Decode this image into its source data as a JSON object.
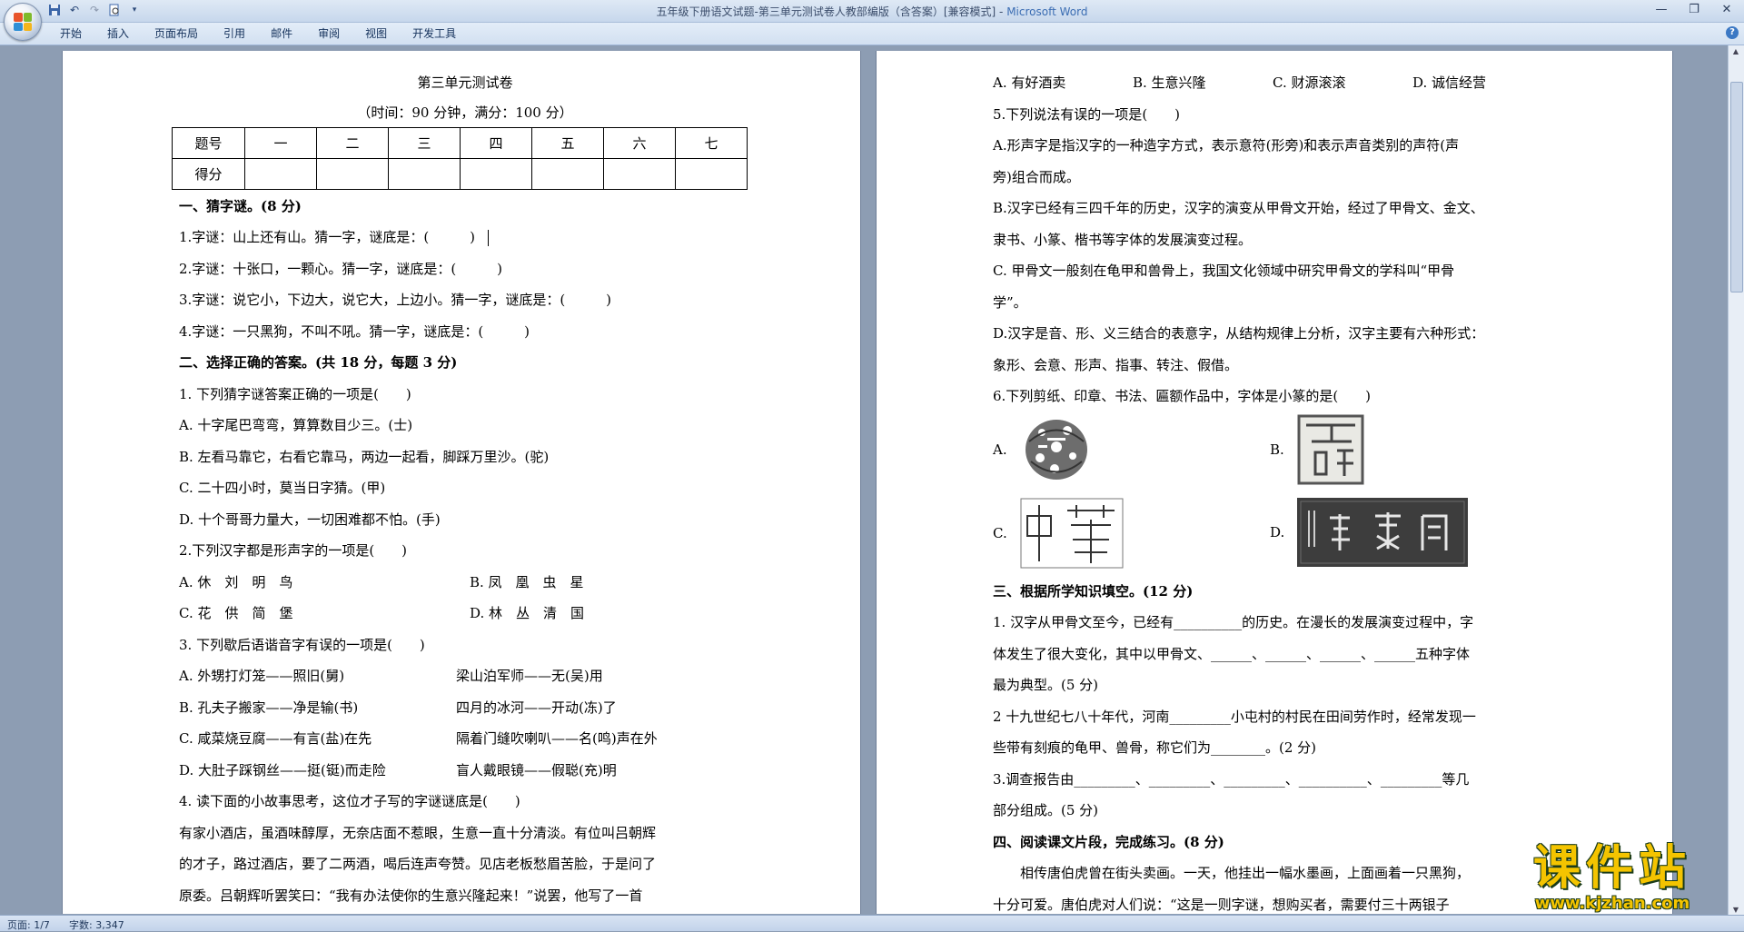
{
  "window": {
    "title": "五年级下册语文试题-第三单元测试卷人教部编版（含答案）[兼容模式]",
    "app_name": "Microsoft Word",
    "title_separator": " - "
  },
  "ribbon": {
    "tabs": [
      "开始",
      "插入",
      "页面布局",
      "引用",
      "邮件",
      "审阅",
      "视图",
      "开发工具"
    ]
  },
  "left_page": {
    "title": "第三单元测试卷",
    "subtitle": "（时间：90 分钟，满分：100 分）",
    "table": {
      "header": [
        "题号",
        "一",
        "二",
        "三",
        "四",
        "五",
        "六",
        "七"
      ],
      "row_label": "得分"
    },
    "lines": [
      {
        "text": "一、猜字谜。(8 分)",
        "bold": true
      },
      {
        "text": "1.字谜：山上还有山。猜一字，谜底是：(　　　)"
      },
      {
        "text": "2.字谜：十张口，一颗心。猜一字，谜底是：(　　　)"
      },
      {
        "text": "3.字谜：说它小，下边大，说它大，上边小。猜一字，谜底是：(　　　)"
      },
      {
        "text": "4.字谜：一只黑狗，不叫不吼。猜一字，谜底是：(　　　)"
      },
      {
        "text": "二、选择正确的答案。(共 18 分，每题 3 分)",
        "bold": true
      },
      {
        "text": "1. 下列猜字谜答案正确的一项是(　　)"
      },
      {
        "text": "A. 十字尾巴弯弯，算算数目少三。(士)"
      },
      {
        "text": "B. 左看马靠它，右看它靠马，两边一起看，脚踩万里沙。(驼)"
      },
      {
        "text": "C. 二十四小时，莫当日字猜。(甲)"
      },
      {
        "text": "D. 十个哥哥力量大，一切困难都不怕。(手)"
      },
      {
        "text": "2.下列汉字都是形声字的一项是(　　)"
      }
    ],
    "q2_options": [
      [
        "A. 休　刘　明　鸟",
        "B. 凤　凰　虫　星"
      ],
      [
        "C. 花　供　简　堡",
        "D. 林　丛　清　国"
      ]
    ],
    "q3_title": "3. 下列歇后语谐音字有误的一项是(　　)",
    "q3_options": [
      [
        "A. 外甥打灯笼——照旧(舅)",
        "梁山泊军师——无(吴)用"
      ],
      [
        "B. 孔夫子搬家——净是输(书)",
        "四月的冰河——开动(冻)了"
      ],
      [
        "C. 咸菜烧豆腐——有言(盐)在先",
        "隔着门缝吹喇叭——名(鸣)声在外"
      ],
      [
        "D. 大肚子踩钢丝——挺(铤)而走险",
        "盲人戴眼镜——假聪(充)明"
      ]
    ],
    "tail_lines": [
      "4. 读下面的小故事思考，这位才子写的字谜谜底是(　　)",
      "有家小酒店，虽酒味醇厚，无奈店面不惹眼，生意一直十分清淡。有位叫吕朝辉",
      "的才子，路过酒店，要了二两酒，喝后连声夸赞。见店老板愁眉苦脸，于是问了",
      "原委。吕朝辉听罢笑曰：“我有办法使你的生意兴隆起来！”说罢，他写了一首"
    ]
  },
  "right_page": {
    "q4_options": [
      "A. 有好酒卖",
      "B. 生意兴隆",
      "C. 财源滚滚",
      "D. 诚信经营"
    ],
    "lines": [
      {
        "text": "5.下列说法有误的一项是(　　)"
      },
      {
        "text": "A.形声字是指汉字的一种造字方式，表示意符(形旁)和表示声音类别的声符(声"
      },
      {
        "text": "旁)组合而成。"
      },
      {
        "text": "B.汉字已经有三四千年的历史，汉字的演变从甲骨文开始，经过了甲骨文、金文、"
      },
      {
        "text": "隶书、小篆、楷书等字体的发展演变过程。"
      },
      {
        "text": "C. 甲骨文一般刻在龟甲和兽骨上，我国文化领域中研究甲骨文的学科叫“甲骨"
      },
      {
        "text": "学”。"
      },
      {
        "text": "D.汉字是音、形、义三结合的表意字，从结构规律上分析，汉字主要有六种形式："
      },
      {
        "text": "象形、会意、形声、指事、转注、假借。"
      },
      {
        "text": "6.下列剪纸、印章、书法、匾额作品中，字体是小篆的是(　　)"
      }
    ],
    "q6_labels": [
      "A.",
      "B.",
      "C.",
      "D."
    ],
    "section3": [
      {
        "text": "三、根据所学知识填空。(12 分)",
        "bold": true
      },
      {
        "text": "1. 汉字从甲骨文至今，已经有__________的历史。在漫长的发展演变过程中，字"
      },
      {
        "text": "体发生了很大变化，其中以甲骨文、______、______、______、______五种字体"
      },
      {
        "text": "最为典型。(5 分)"
      },
      {
        "text": "2 十九世纪七八十年代，河南_________小屯村的村民在田间劳作时，经常发现一"
      },
      {
        "text": "些带有刻痕的龟甲、兽骨，称它们为________。(2 分)"
      },
      {
        "text": "3.调查报告由_________、_________、_________、__________、_________等几"
      },
      {
        "text": "部分组成。(5 分)"
      },
      {
        "text": "四、阅读课文片段，完成练习。(8 分)",
        "bold": true
      },
      {
        "text": "　　相传唐伯虎曾在街头卖画。一天，他挂出一幅水墨画，上面画着一只黑狗，"
      },
      {
        "text": "十分可爱。唐伯虎对人们说：“这是一则字谜，想购买者，需要付三十两银子"
      }
    ]
  },
  "status": {
    "page": "页面: 1/7",
    "words": "字数: 3,347"
  },
  "watermark": {
    "title": "课件站",
    "url": "www.kjzhan.com"
  },
  "colors": {
    "accent": "#3b6db3",
    "workspace": "#8d9db3",
    "watermark": "#f4c400"
  }
}
